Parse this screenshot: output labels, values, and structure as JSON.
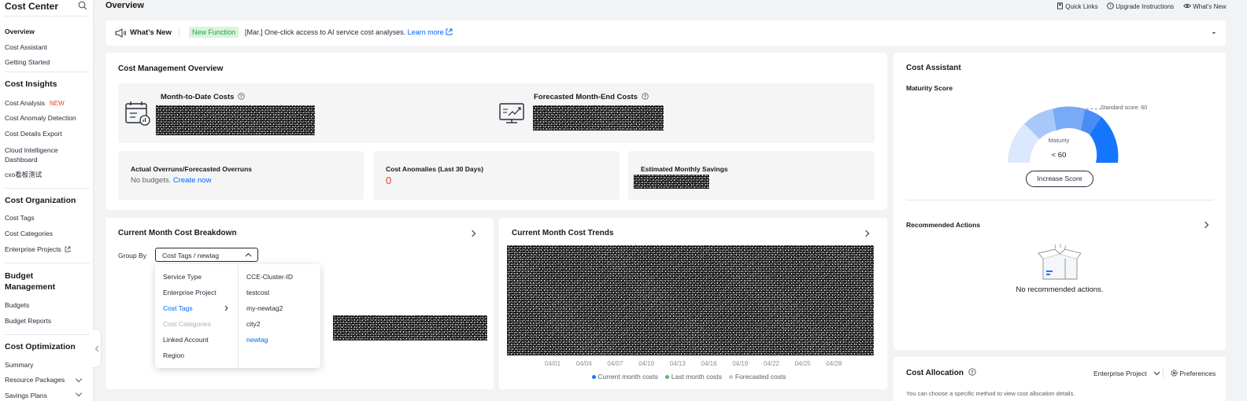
{
  "sidebar": {
    "title": "Cost Center",
    "overview": "Overview",
    "cost_assistant": "Cost Assistant",
    "getting_started": "Getting Started",
    "insights": {
      "heading": "Cost Insights",
      "cost_analysis": "Cost Analysis",
      "new_badge": "NEW",
      "anomaly": "Cost Anomaly Detection",
      "export": "Cost Details Export",
      "cloud_intel_1": "Cloud Intelligence",
      "cloud_intel_2": "Dashboard",
      "cxo": "cxo看板测试"
    },
    "organization": {
      "heading": "Cost Organization",
      "tags": "Cost Tags",
      "categories": "Cost Categories",
      "enterprise": "Enterprise Projects"
    },
    "budget": {
      "heading_1": "Budget",
      "heading_2": "Management",
      "budgets": "Budgets",
      "reports": "Budget Reports"
    },
    "optimization": {
      "heading": "Cost Optimization",
      "summary": "Summary",
      "packages": "Resource Packages",
      "savings": "Savings Plans"
    }
  },
  "header": {
    "title": "Overview",
    "quick_links": "Quick Links",
    "upgrade": "Upgrade Instructions",
    "whats_new": "What's New"
  },
  "banner": {
    "title": "What's New",
    "tag": "New Function",
    "text": "[Mar.] One-click access to AI service cost analyses.",
    "learn_more": "Learn more",
    "collapse": "-"
  },
  "overview_card": {
    "title": "Cost Management Overview",
    "mtd_label": "Month-to-Date Costs",
    "forecast_label": "Forecasted Month-End Costs",
    "overruns_label": "Actual Overruns/Forecasted Overruns",
    "no_budgets": "No budgets.",
    "create_now": "Create now",
    "anomalies_label": "Cost Anomalies (Last 30 Days)",
    "anomalies_value": "0",
    "savings_label": "Estimated Monthly Savings"
  },
  "breakdown": {
    "title": "Current Month Cost Breakdown",
    "group_by": "Group By",
    "select_value": "Cost Tags / newtag",
    "left_options": [
      "Service Type",
      "Enterprise Project",
      "Cost Tags",
      "Cost Categories",
      "Linked Account",
      "Region"
    ],
    "right_options": [
      "CCE-Cluster-ID",
      "testcost",
      "my-newtag2",
      "city2",
      "newtag"
    ]
  },
  "trends": {
    "title": "Current Month Cost Trends",
    "x_ticks": [
      "04/01",
      "04/04",
      "04/07",
      "04/10",
      "04/13",
      "04/16",
      "04/19",
      "04/22",
      "04/25",
      "04/28"
    ],
    "legend": [
      "Current month costs",
      "Last month costs",
      "Forecasted costs"
    ],
    "legend_colors": [
      "#1476ff",
      "#50b86c",
      "#c2c6cc"
    ]
  },
  "assistant": {
    "title": "Cost Assistant",
    "maturity_score": "Maturity Score",
    "standard_score": "Standard score: 60",
    "maturity": "Maturity",
    "score": "< 60",
    "increase": "Increase Score",
    "recommended": "Recommended Actions",
    "no_actions": "No recommended actions."
  },
  "allocation": {
    "title": "Cost Allocation",
    "dimension": "Enterprise Project",
    "preferences": "Preferences",
    "description": "You can choose a specific method to view cost allocation details."
  },
  "colors": {
    "accent": "#0064ff",
    "green_tag_bg": "#d7f5dc",
    "green_tag_text": "#2a9d4a",
    "danger": "#e84026"
  }
}
